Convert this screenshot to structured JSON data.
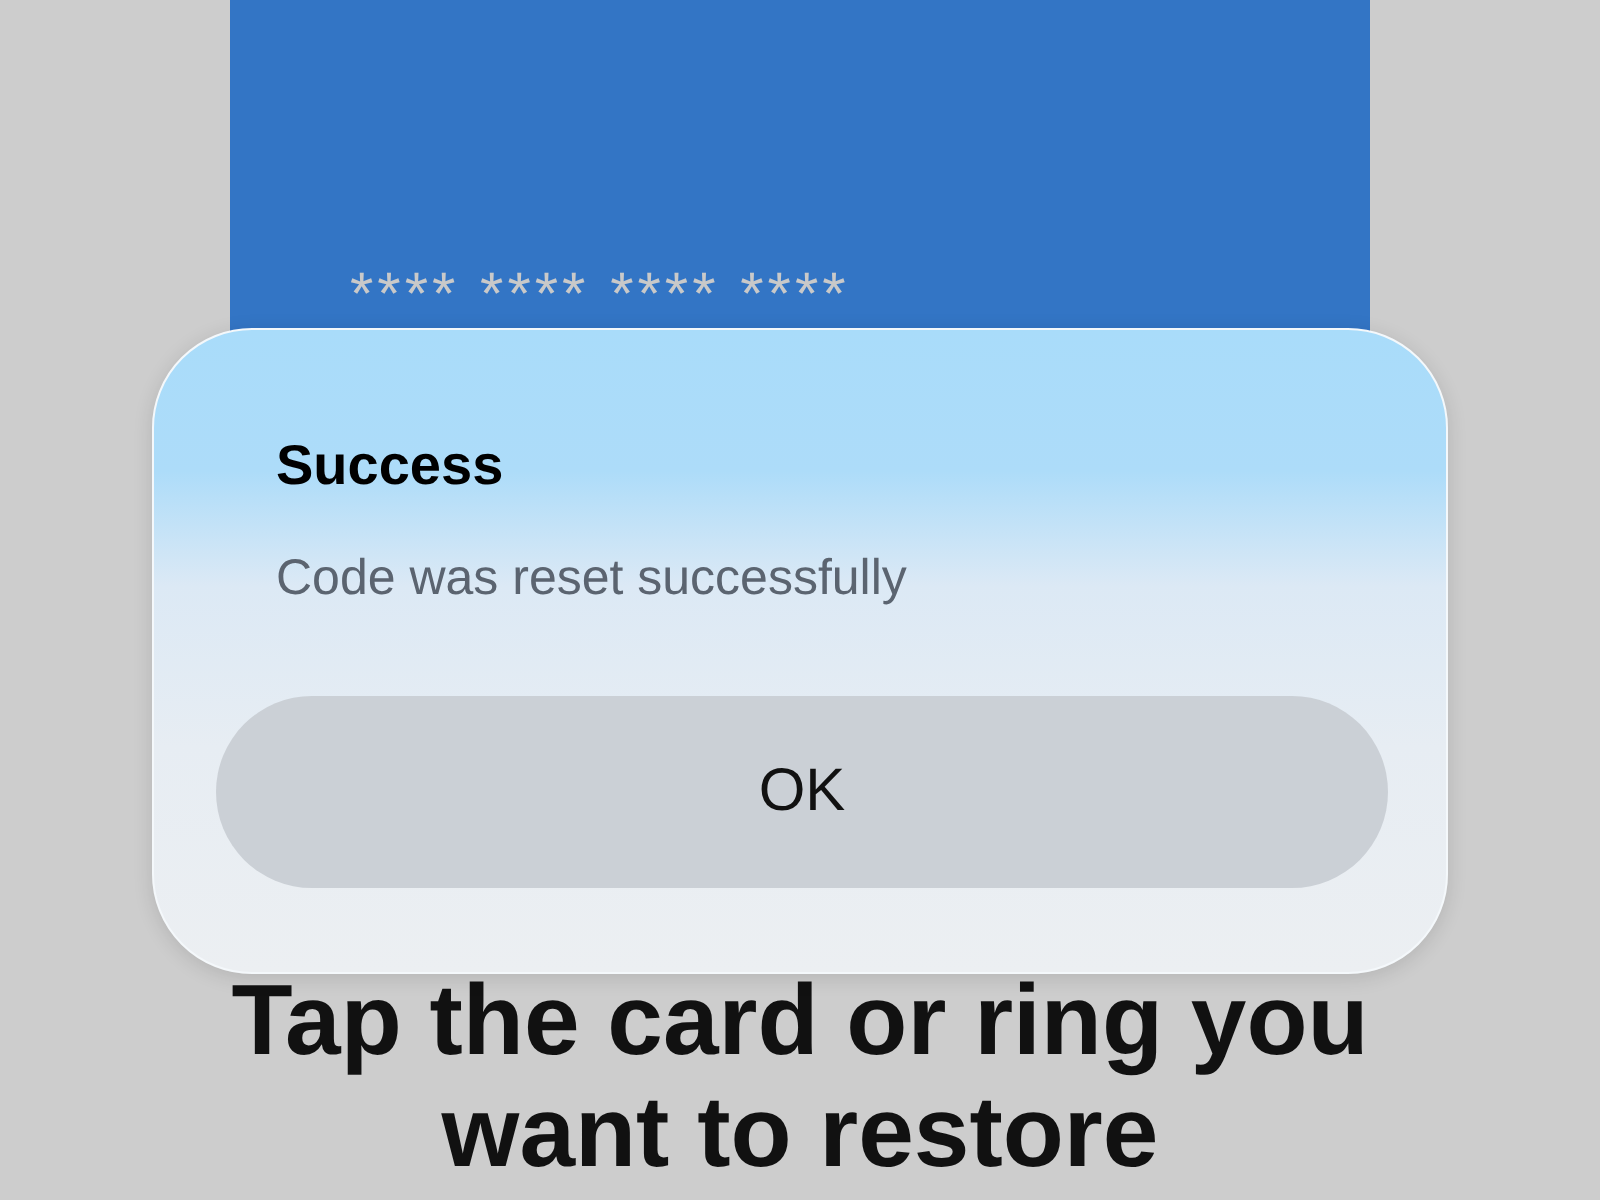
{
  "card": {
    "number": "**** **** **** ****"
  },
  "dialog": {
    "title": "Success",
    "message": "Code was reset successfully",
    "button": "OK"
  },
  "heading": "Tap the card or ring you want to restore"
}
